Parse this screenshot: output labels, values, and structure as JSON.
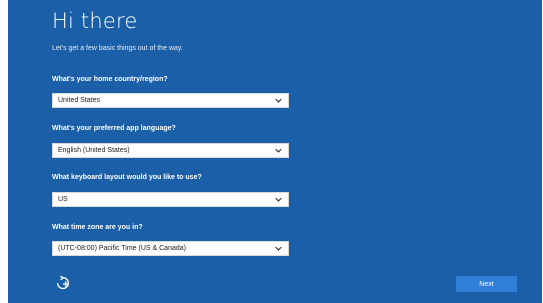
{
  "screen": {
    "title": "Hi there",
    "subtitle": "Let's get a few basic things out of the way."
  },
  "fields": [
    {
      "question": "What's your home country/region?",
      "value": "United States"
    },
    {
      "question": "What's your preferred app language?",
      "value": "English (United States)"
    },
    {
      "question": "What keyboard layout would you like to use?",
      "value": "US"
    },
    {
      "question": "What time zone are you in?",
      "value": "(UTC-08:00) Pacific Time (US & Canada)"
    }
  ],
  "footer": {
    "ease_of_access_icon": "ease-of-access-icon",
    "next_label": "Next"
  },
  "colors": {
    "background": "#1a5fa8",
    "button": "#2f7fd6",
    "text": "#ffffff"
  }
}
